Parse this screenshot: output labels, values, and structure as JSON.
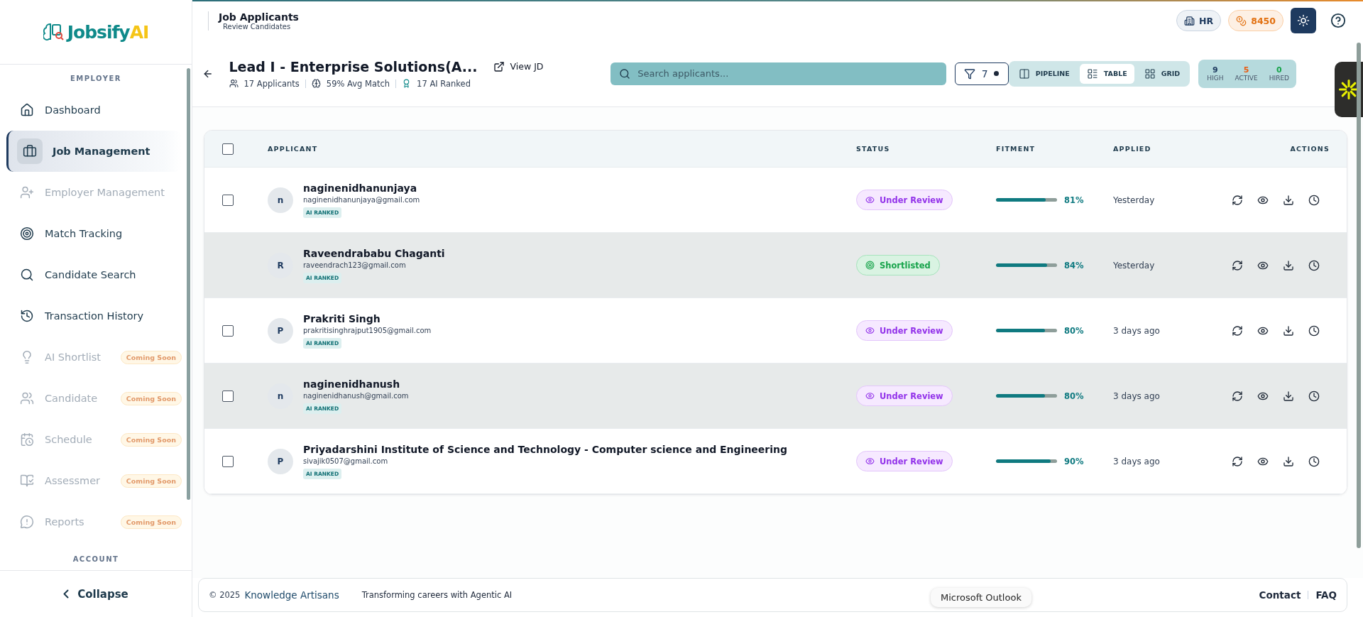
{
  "sidebar": {
    "logo": {
      "text": "Jobsify",
      "accent": "AI"
    },
    "section_label": "EMPLOYER",
    "items": [
      {
        "label": "Dashboard",
        "selected": false,
        "disabled": false
      },
      {
        "label": "Job Management",
        "selected": true,
        "disabled": false
      },
      {
        "label": "Employer Management",
        "selected": false,
        "disabled": true
      },
      {
        "label": "Match Tracking",
        "selected": false,
        "disabled": false
      },
      {
        "label": "Candidate Search",
        "selected": false,
        "disabled": false
      },
      {
        "label": "Transaction History",
        "selected": false,
        "disabled": false
      },
      {
        "label": "AI Shortlist",
        "selected": false,
        "disabled": true,
        "badge": "Coming Soon"
      },
      {
        "label": "Candidate",
        "selected": false,
        "disabled": true,
        "badge": "Coming Soon"
      },
      {
        "label": "Schedule",
        "selected": false,
        "disabled": true,
        "badge": "Coming Soon"
      },
      {
        "label": "Assessmer",
        "selected": false,
        "disabled": true,
        "badge": "Coming Soon"
      },
      {
        "label": "Reports",
        "selected": false,
        "disabled": true,
        "badge": "Coming Soon"
      }
    ],
    "account_label": "ACCOUNT",
    "collapse": "Collapse"
  },
  "header": {
    "title": "Job Applicants",
    "subtitle": "Review Candidates",
    "role": "HR",
    "credits": "8450"
  },
  "job": {
    "title": "Lead I - Enterprise Solutions(A...",
    "view_jd": "View JD",
    "applicants": "17 Applicants",
    "avg_match": "59% Avg Match",
    "ai_ranked": "17 AI Ranked"
  },
  "search": {
    "placeholder": "Search applicants..."
  },
  "filter": {
    "count": "7"
  },
  "views": [
    {
      "label": "PIPELINE",
      "selected": false
    },
    {
      "label": "TABLE",
      "selected": true
    },
    {
      "label": "GRID",
      "selected": false
    }
  ],
  "stats": [
    {
      "value": "9",
      "label": "HIGH",
      "color": "#1e3a5f"
    },
    {
      "value": "5",
      "label": "ACTIVE",
      "color": "#ea580c"
    },
    {
      "value": "0",
      "label": "HIRED",
      "color": "#16a34a"
    }
  ],
  "table": {
    "select_all_checked": false,
    "columns": [
      "APPLICANT",
      "STATUS",
      "FITMENT",
      "APPLIED",
      "ACTIONS"
    ],
    "rows": [
      {
        "initial": "n",
        "name": "naginenidhanunjaya",
        "email": "naginenidhanunjaya@gmail.com",
        "tag": "AI RANKED",
        "status": {
          "label": "Under Review",
          "kind": "review"
        },
        "level": 0.81,
        "fitment": "81%",
        "applied": "Yesterday",
        "checked": false,
        "highlighted": false
      },
      {
        "initial": "R",
        "name": "Raveendrababu Chaganti",
        "email": "raveendrach123@gmail.com",
        "tag": "AI RANKED",
        "status": {
          "label": "Shortlisted",
          "kind": "shortlisted"
        },
        "level": 0.84,
        "fitment": "84%",
        "applied": "Yesterday",
        "highlighted": true
      },
      {
        "initial": "P",
        "name": "Prakriti Singh",
        "email": "prakritisinghrajput1905@gmail.com",
        "tag": "AI RANKED",
        "status": {
          "label": "Under Review",
          "kind": "review"
        },
        "level": 0.8,
        "fitment": "80%",
        "applied": "3 days ago",
        "checked": false,
        "highlighted": false
      },
      {
        "initial": "n",
        "name": "naginenidhanush",
        "email": "naginenidhanush@gmail.com",
        "tag": "AI RANKED",
        "status": {
          "label": "Under Review",
          "kind": "review"
        },
        "level": 0.8,
        "fitment": "80%",
        "applied": "3 days ago",
        "checked": false,
        "highlighted": true
      },
      {
        "initial": "P",
        "name": "Priyadarshini Institute of Science and Technology - Computer science and Engineering",
        "email": "sivajik0507@gmail.com",
        "tag": "AI RANKED",
        "status": {
          "label": "Under Review",
          "kind": "review"
        },
        "level": 0.9,
        "fitment": "90%",
        "applied": "3 days ago",
        "checked": false,
        "highlighted": false
      }
    ]
  },
  "footer": {
    "copyright": "© 2025",
    "company": "Knowledge Artisans",
    "tagline": "Transforming careers with Agentic AI",
    "links": [
      "Contact",
      "FAQ"
    ]
  },
  "tooltip": "Microsoft Outlook"
}
